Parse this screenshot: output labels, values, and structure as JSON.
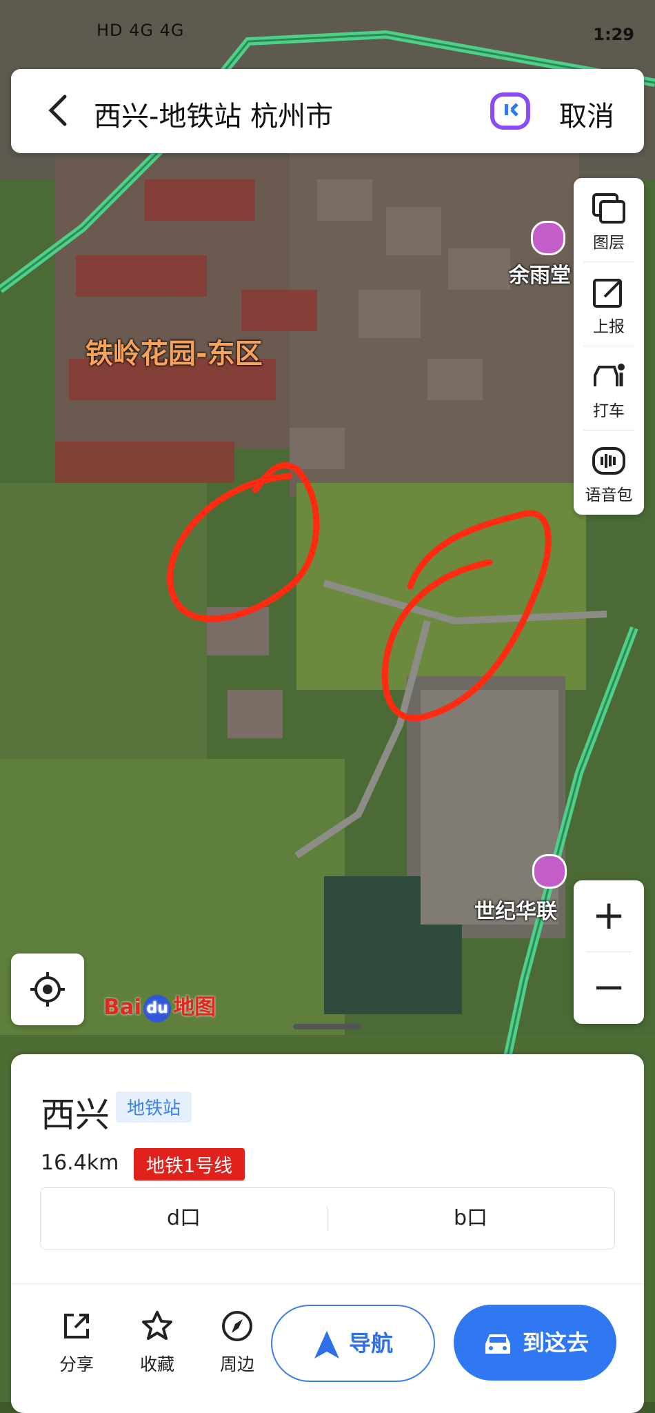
{
  "status_bar": {
    "left": "HD 4G 4G",
    "time": "1:29"
  },
  "search": {
    "query": "西兴-地铁站 杭州市",
    "cancel_label": "取消"
  },
  "tools": [
    {
      "label": "图层",
      "icon": "layers-icon"
    },
    {
      "label": "上报",
      "icon": "report-edit-icon"
    },
    {
      "label": "打车",
      "icon": "taxi-icon"
    },
    {
      "label": "语音包",
      "icon": "voice-pack-icon"
    }
  ],
  "map_labels": {
    "residential": "铁岭花园-东区",
    "poi_top": "余雨堂",
    "poi_bottom": "世纪华联",
    "watermark": "Baidu"
  },
  "logo": {
    "left": "Bai",
    "paw": "du",
    "right": "地图"
  },
  "zoom": {
    "plus": "+",
    "minus": "−"
  },
  "place": {
    "name": "西兴",
    "category": "地铁站",
    "distance": "16.4km",
    "line": "地铁1号线",
    "exits": [
      "d口",
      "b口"
    ]
  },
  "actions": {
    "share": "分享",
    "favorite": "收藏",
    "nearby": "周边"
  },
  "buttons": {
    "navigate": "导航",
    "go": "到这去"
  },
  "colors": {
    "accent_blue": "#2f78f1",
    "line_red": "#e0211c",
    "annotation_red": "#ff2a12",
    "road_green": "#4fd08a"
  }
}
